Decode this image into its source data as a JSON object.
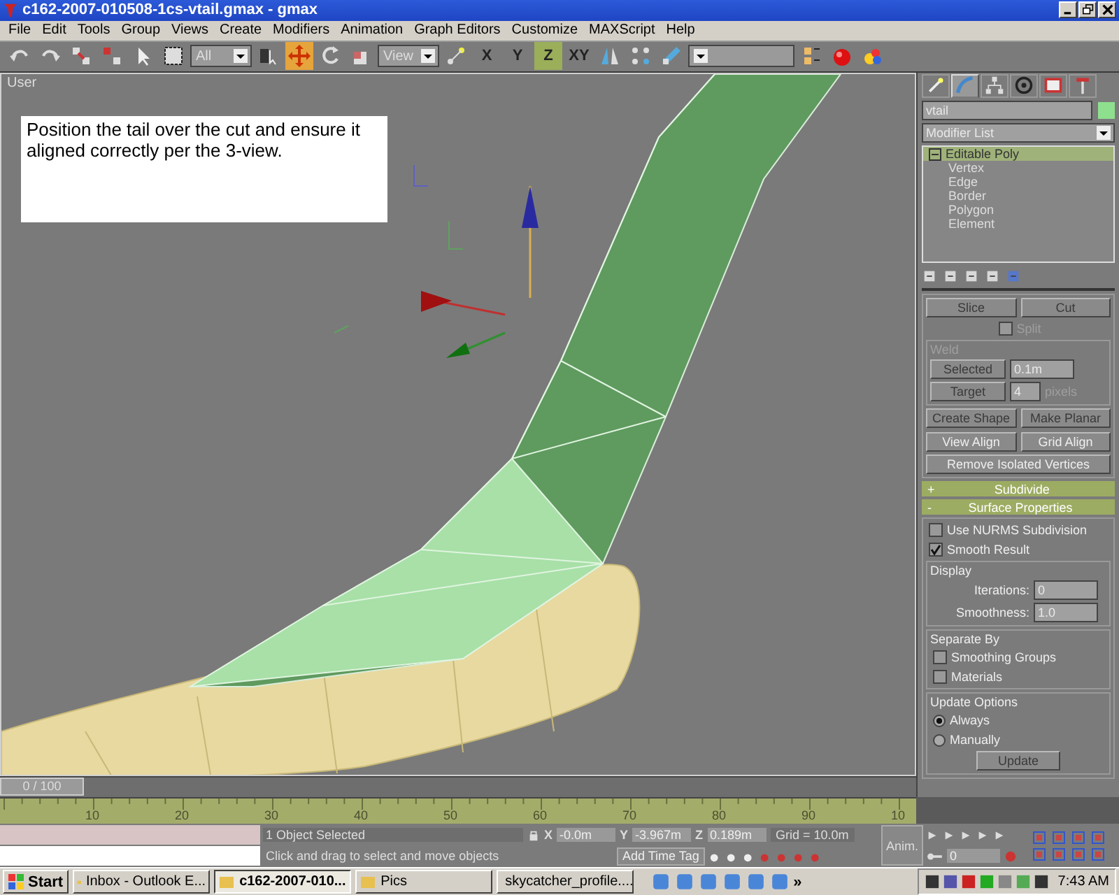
{
  "window": {
    "title": "c162-2007-010508-1cs-vtail.gmax - gmax"
  },
  "menu": [
    "File",
    "Edit",
    "Tools",
    "Group",
    "Views",
    "Create",
    "Modifiers",
    "Animation",
    "Graph Editors",
    "Customize",
    "MAXScript",
    "Help"
  ],
  "toolbar": [
    {
      "kind": "icon",
      "active": false
    },
    {
      "kind": "icon",
      "active": false
    },
    {
      "kind": "icon",
      "active": false
    },
    {
      "kind": "icon",
      "active": false
    },
    {
      "kind": "icon",
      "active": false
    },
    {
      "kind": "icon",
      "active": false
    },
    {
      "kind": "dropdown",
      "value": "All"
    },
    {
      "kind": "icon",
      "active": false
    },
    {
      "kind": "icon",
      "active": true
    },
    {
      "kind": "icon",
      "active": false
    },
    {
      "kind": "icon",
      "active": false
    },
    {
      "kind": "dropdown",
      "value": "View"
    },
    {
      "kind": "icon",
      "active": false
    },
    {
      "kind": "letter",
      "label": "X",
      "active": false
    },
    {
      "kind": "letter",
      "label": "Y",
      "active": false
    },
    {
      "kind": "letter",
      "label": "Z",
      "active": true
    },
    {
      "kind": "letter",
      "label": "XY",
      "active": false
    },
    {
      "kind": "icon",
      "active": false
    },
    {
      "kind": "icon",
      "active": false
    },
    {
      "kind": "icon",
      "active": false
    },
    {
      "kind": "dropdown"
    },
    {
      "kind": "icon",
      "active": false
    },
    {
      "kind": "icon",
      "active": false
    },
    {
      "kind": "icon",
      "active": false
    }
  ],
  "viewport": {
    "label": "User",
    "note": "Position the tail over the cut and ensure it aligned correctly per the 3-view."
  },
  "command_tabs": [
    {
      "selected": false
    },
    {
      "selected": true
    },
    {
      "selected": false
    },
    {
      "selected": false
    },
    {
      "selected": false
    },
    {
      "selected": false
    }
  ],
  "object_name": "vtail",
  "modifier_list": "Modifier List",
  "stack": {
    "label": "Editable Poly",
    "expanded": true,
    "selected": true,
    "children": [
      {
        "label": "Vertex",
        "selected": false
      },
      {
        "label": "Edge",
        "selected": false
      },
      {
        "label": "Border",
        "selected": false
      },
      {
        "label": "Polygon",
        "selected": false
      },
      {
        "label": "Element",
        "selected": false
      }
    ]
  },
  "edit_buttons": [
    {
      "label": "Slice",
      "disabled": true
    },
    {
      "label": "Cut",
      "disabled": true
    }
  ],
  "split": {
    "label": "Split",
    "checked": false,
    "disabled": true
  },
  "weld": {
    "title": "Weld",
    "rows": [
      {
        "label": "Selected",
        "value": "0.1m",
        "disabled": true
      },
      {
        "label": "Target",
        "value": "4",
        "unit": "pixels",
        "disabled": true
      }
    ]
  },
  "align_buttons": [
    {
      "label": "Create Shape",
      "disabled": true
    },
    {
      "label": "Make Planar",
      "disabled": true
    },
    {
      "label": "View Align",
      "disabled": false
    },
    {
      "label": "Grid Align",
      "disabled": false
    }
  ],
  "remove_button": {
    "label": "Remove Isolated Vertices",
    "disabled": false
  },
  "rollouts": [
    {
      "sign": "+",
      "title": "Subdivide"
    },
    {
      "sign": "-",
      "title": "Surface Properties"
    }
  ],
  "surface_checks": [
    {
      "label": "Use NURMS Subdivision",
      "checked": false
    },
    {
      "label": "Smooth Result",
      "checked": true
    }
  ],
  "display": {
    "title": "Display",
    "fields": [
      {
        "label": "Iterations:",
        "value": "0"
      },
      {
        "label": "Smoothness:",
        "value": "1.0"
      }
    ]
  },
  "separate": {
    "title": "Separate By",
    "checks": [
      {
        "label": "Smoothing Groups",
        "checked": false
      },
      {
        "label": "Materials",
        "checked": false
      }
    ]
  },
  "update": {
    "title": "Update Options",
    "options": [
      {
        "label": "Always",
        "selected": true
      },
      {
        "label": "Manually",
        "selected": false
      }
    ],
    "button": {
      "label": "Update",
      "disabled": true
    }
  },
  "time_slider": {
    "label": "0 / 100",
    "level": 0
  },
  "ruler": [
    "10",
    "20",
    "30",
    "40",
    "50",
    "60",
    "70",
    "80",
    "90",
    "10"
  ],
  "status": {
    "selected": "1 Object Selected",
    "prompt": "Click and drag to select and move objects",
    "coords": [
      {
        "axis": "X",
        "value": "-0.0m"
      },
      {
        "axis": "Y",
        "value": "-3.967m"
      },
      {
        "axis": "Z",
        "value": "0.189m"
      }
    ],
    "grid": "Grid = 10.0m",
    "time_tag": "Add Time Tag",
    "anim": "Anim.",
    "frame": "0"
  },
  "taskbar": {
    "start": "Start",
    "tasks": [
      {
        "label": "Inbox - Outlook E...",
        "selected": false
      },
      {
        "label": "c162-2007-010...",
        "selected": true
      },
      {
        "label": "Pics",
        "selected": false
      },
      {
        "label": "skycatcher_profile....",
        "selected": false
      }
    ],
    "chevron": "»",
    "clock": "7:43 AM"
  }
}
